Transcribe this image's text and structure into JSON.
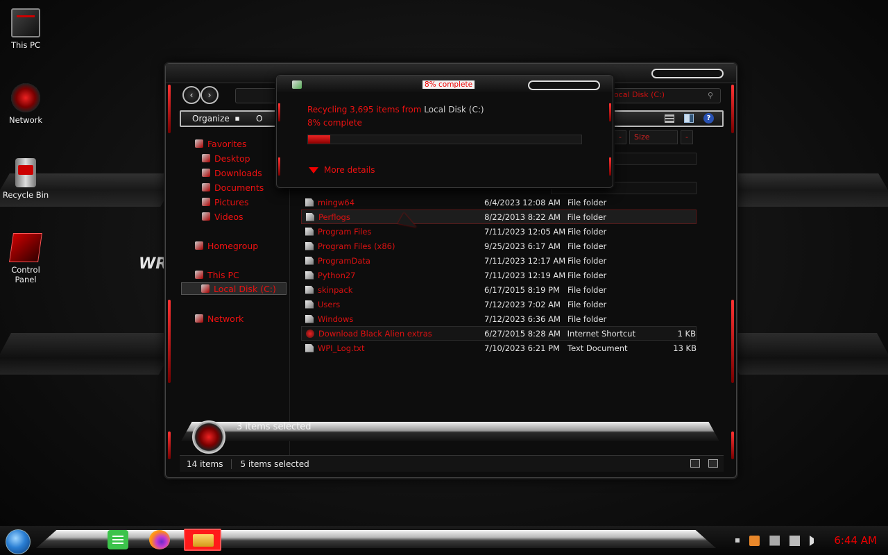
{
  "desktop": {
    "icons": [
      {
        "label": "This PC",
        "icon": "this-pc-icon"
      },
      {
        "label": "Network",
        "icon": "network-icon"
      },
      {
        "label": "Recycle Bin",
        "icon": "recycle-bin-icon"
      },
      {
        "label": "Control Panel",
        "icon": "control-panel-icon"
      }
    ],
    "wallpaper_text": "WR"
  },
  "explorer": {
    "address": "Local Disk (C:)",
    "toolbar": {
      "organize_label": "Organize",
      "open_label": "O"
    },
    "column_headers": [
      "-",
      "Size",
      "-"
    ],
    "nav": {
      "favorites": "Favorites",
      "desktop": "Desktop",
      "downloads": "Downloads",
      "documents": "Documents",
      "pictures": "Pictures",
      "videos": "Videos",
      "homegroup": "Homegroup",
      "this_pc": "This PC",
      "local_disk": "Local Disk (C:)",
      "network": "Network"
    },
    "files": [
      {
        "name": "mingw64",
        "date": "6/4/2023 12:08 AM",
        "type": "File folder",
        "size": ""
      },
      {
        "name": "Perflogs",
        "date": "8/22/2013 8:22 AM",
        "type": "File folder",
        "size": ""
      },
      {
        "name": "Program Files",
        "date": "7/11/2023 12:05 AM",
        "type": "File folder",
        "size": ""
      },
      {
        "name": "Program Files (x86)",
        "date": "9/25/2023 6:17 AM",
        "type": "File folder",
        "size": ""
      },
      {
        "name": "ProgramData",
        "date": "7/11/2023 12:17 AM",
        "type": "File folder",
        "size": ""
      },
      {
        "name": "Python27",
        "date": "7/11/2023 12:19 AM",
        "type": "File folder",
        "size": ""
      },
      {
        "name": "skinpack",
        "date": "6/17/2015 8:19 PM",
        "type": "File folder",
        "size": ""
      },
      {
        "name": "Users",
        "date": "7/12/2023 7:02 AM",
        "type": "File folder",
        "size": ""
      },
      {
        "name": "Windows",
        "date": "7/12/2023 6:36 AM",
        "type": "File folder",
        "size": ""
      },
      {
        "name": "Download Black Alien extras",
        "date": "6/27/2015 8:28 AM",
        "type": "Internet Shortcut",
        "size": "1 KB"
      },
      {
        "name": "WPI_Log.txt",
        "date": "7/10/2023 6:21 PM",
        "type": "Text Document",
        "size": "13 KB"
      }
    ],
    "selection_banner": "3 items selected",
    "status": {
      "item_count": "14 items",
      "selected_count": "5 items selected"
    }
  },
  "progress_dialog": {
    "title": "8% complete",
    "line1_prefix": "Recycling 3,695 items from ",
    "line1_source": "Local Disk (C:)",
    "line2": "8% complete",
    "progress_fraction": 0.08,
    "more_details": "More details"
  },
  "taskbar": {
    "clock": "6:44 AM",
    "apps": [
      "chat-app-icon",
      "firefox-icon",
      "file-explorer-icon"
    ]
  },
  "colors": {
    "accent": "#e00000",
    "text_light": "#e6e6e6"
  }
}
